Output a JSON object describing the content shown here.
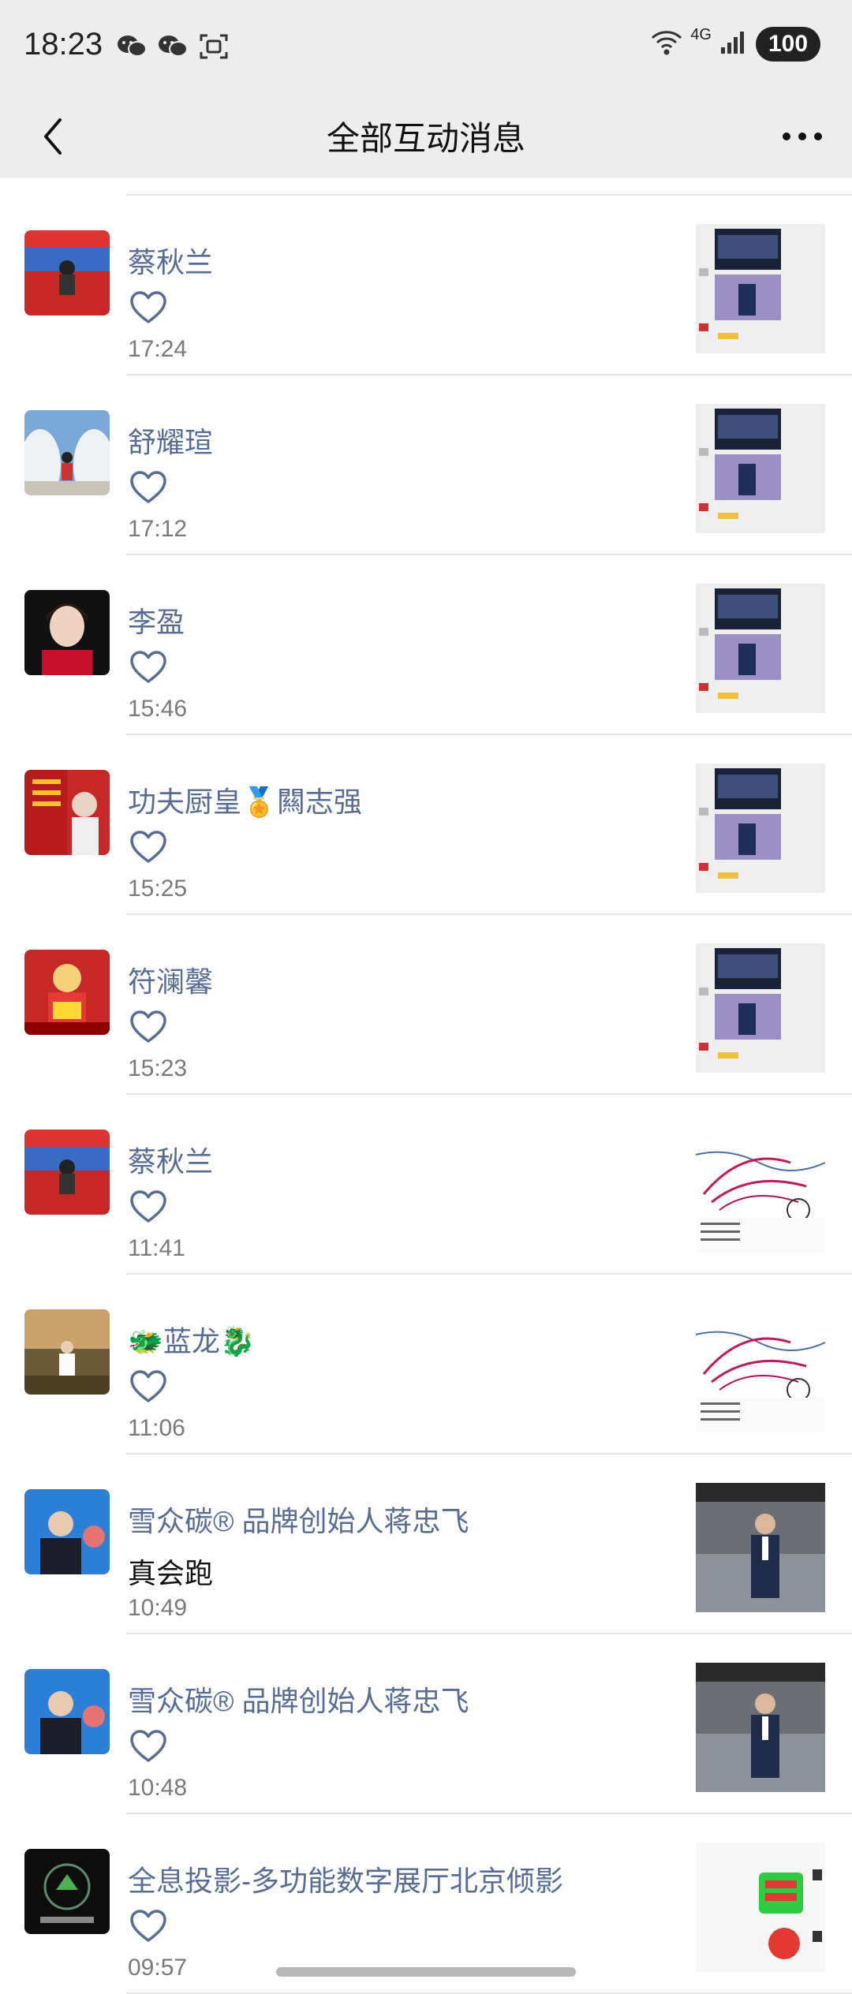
{
  "status": {
    "time": "18:23",
    "network_label": "4G",
    "battery": "100",
    "icons": [
      "wechat-icon",
      "wechat-icon",
      "scan-icon",
      "wifi-icon",
      "signal-icon"
    ]
  },
  "header": {
    "title": "全部互动消息",
    "back_icon": "chevron-left-icon",
    "more_icon": "more-dots-icon"
  },
  "colors": {
    "name": "#576b95",
    "bar_bg": "#ededed",
    "time": "#7a7a7a"
  },
  "items": [
    {
      "name": "蔡秋兰",
      "type": "like",
      "time": "17:24",
      "avatar": "avatar-a",
      "thumb": "screenshot"
    },
    {
      "name": "舒耀瑄",
      "type": "like",
      "time": "17:12",
      "avatar": "avatar-b",
      "thumb": "screenshot"
    },
    {
      "name": "李盈",
      "type": "like",
      "time": "15:46",
      "avatar": "avatar-c",
      "thumb": "screenshot"
    },
    {
      "name": "功夫厨皇🏅闗志强",
      "type": "like",
      "time": "15:25",
      "avatar": "avatar-d",
      "thumb": "screenshot"
    },
    {
      "name": "符澜馨",
      "type": "like",
      "time": "15:23",
      "avatar": "avatar-e",
      "thumb": "screenshot"
    },
    {
      "name": "蔡秋兰",
      "type": "like",
      "time": "11:41",
      "avatar": "avatar-a",
      "thumb": "map"
    },
    {
      "name": "🐲蓝龙🐉",
      "type": "like",
      "time": "11:06",
      "avatar": "avatar-f",
      "thumb": "map"
    },
    {
      "name": "雪众碳®  品牌创始人蒋忠飞",
      "type": "comment",
      "comment": "真会跑",
      "time": "10:49",
      "avatar": "avatar-g",
      "thumb": "photo"
    },
    {
      "name": "雪众碳®  品牌创始人蒋忠飞",
      "type": "like",
      "time": "10:48",
      "avatar": "avatar-g",
      "thumb": "photo"
    },
    {
      "name": "全息投影-多功能数字展厅北京倾影",
      "type": "like",
      "time": "09:57",
      "avatar": "avatar-h",
      "thumb": "poster"
    }
  ]
}
